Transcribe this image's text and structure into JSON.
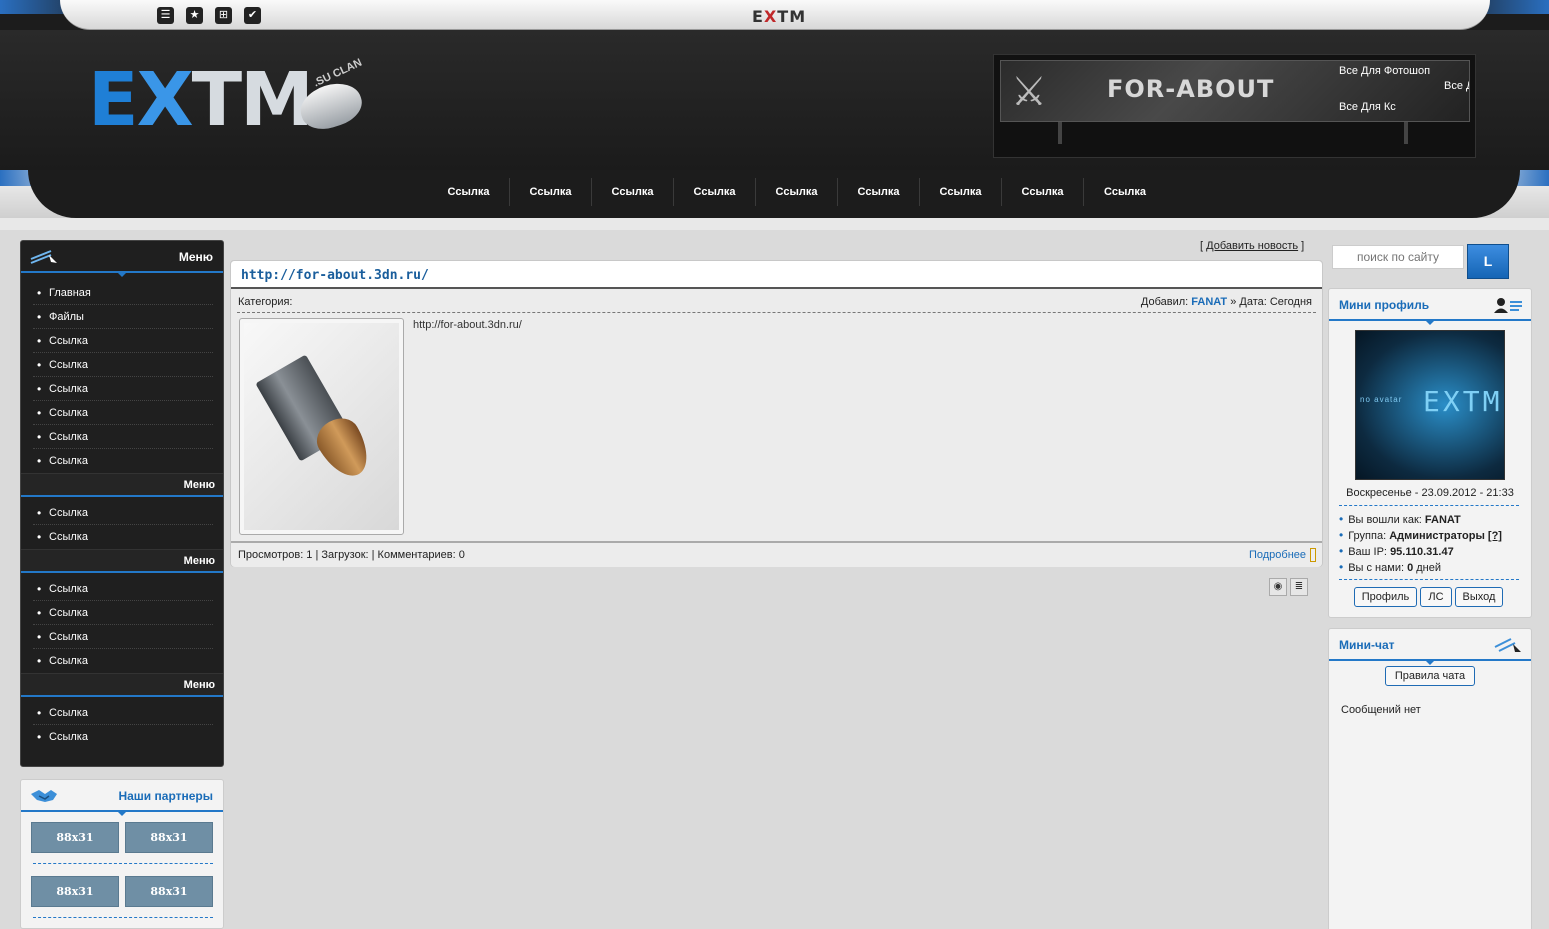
{
  "topbar": {
    "icons": [
      "rss-icon",
      "star-icon",
      "share-icon",
      "check-icon"
    ],
    "logo": {
      "e": "E",
      "x": "X",
      "rest": "TM"
    }
  },
  "header": {
    "logo": {
      "e": "E",
      "x": "X",
      "rest": "TM",
      "sub": ".SU CLAN"
    },
    "banner": {
      "title": "FOR-ABOUT",
      "line1": "Все Для Фотошоп",
      "line2": "Все Д",
      "line3": "Все Для Кс"
    }
  },
  "nav": {
    "items": [
      "Ссылка",
      "Ссылка",
      "Ссылка",
      "Ссылка",
      "Ссылка",
      "Ссылка",
      "Ссылка",
      "Ссылка",
      "Ссылка"
    ]
  },
  "left": {
    "menu_title": "Меню",
    "group1": [
      "Главная",
      "Файлы",
      "Ссылка",
      "Ссылка",
      "Ссылка",
      "Ссылка",
      "Ссылка",
      "Ссылка"
    ],
    "sub2_title": "Меню",
    "group2": [
      "Ссылка",
      "Ссылка"
    ],
    "sub3_title": "Меню",
    "group3": [
      "Ссылка",
      "Ссылка",
      "Ссылка",
      "Ссылка"
    ],
    "sub4_title": "Меню",
    "group4": [
      "Ссылка",
      "Ссылка"
    ],
    "partners_title": "Наши партнеры",
    "partner_buttons": [
      "88x31",
      "88x31",
      "88x31",
      "88x31"
    ]
  },
  "main": {
    "add_news_open": "[ ",
    "add_news": "Добавить новость",
    "add_news_close": " ]",
    "post": {
      "title": "http://for-about.3dn.ru/",
      "category_label": "Категория:",
      "added_label": "Добавил:",
      "author": "FANAT",
      "date_text": " » Дата: Сегодня",
      "body": "http://for-about.3dn.ru/",
      "stats": "Просмотров: 1 | Загрузок:  | Комментариев: 0",
      "more": "Подробнее"
    }
  },
  "right": {
    "search_placeholder": "поиск по сайту",
    "search_button": "L",
    "profile": {
      "title": "Мини профиль",
      "date": "Воскресенье - 23.09.2012 - 21:33",
      "avatar_tag": "no avatar",
      "avatar_logo": "EXTM",
      "login_label": "Вы вошли как:",
      "login_value": "FANAT",
      "group_label": "Группа:",
      "group_value": "Администраторы",
      "group_help": "[?]",
      "ip_label": "Ваш IP:",
      "ip_value": "95.110.31.47",
      "days_label": "Вы с нами:",
      "days_value": "0",
      "days_unit": "дней",
      "btn_profile": "Профиль",
      "btn_pm": "ЛС",
      "btn_logout": "Выход"
    },
    "chat": {
      "title": "Мини-чат",
      "rules": "Правила чата",
      "empty": "Сообщений нет"
    }
  },
  "colors": {
    "accent": "#2378c8",
    "link": "#1a6cb8",
    "dark": "#1f1f1f"
  }
}
